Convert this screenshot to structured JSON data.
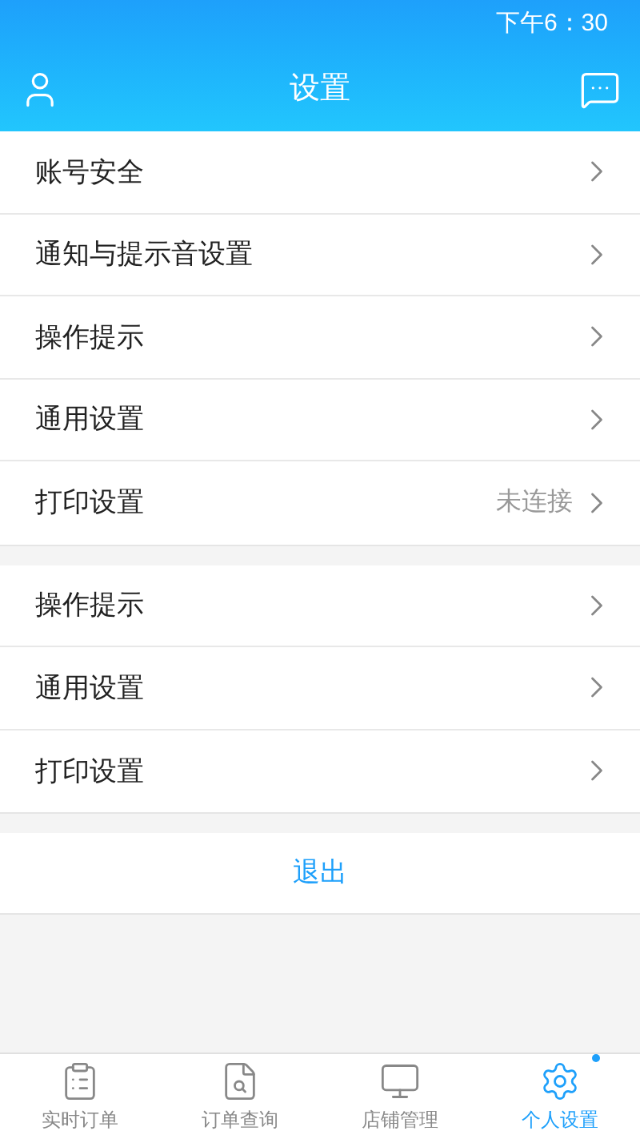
{
  "status_bar": {
    "time": "下午6：30"
  },
  "header": {
    "title": "设置"
  },
  "groups": [
    {
      "items": [
        {
          "label": "账号安全"
        },
        {
          "label": "通知与提示音设置"
        },
        {
          "label": "操作提示"
        },
        {
          "label": "通用设置"
        },
        {
          "label": "打印设置",
          "value": "未连接"
        }
      ]
    },
    {
      "items": [
        {
          "label": "操作提示"
        },
        {
          "label": "通用设置"
        },
        {
          "label": "打印设置"
        }
      ]
    }
  ],
  "logout": "退出",
  "bottom_nav": [
    {
      "label": "实时订单",
      "kind": "clipboard",
      "selected": false,
      "dot": false
    },
    {
      "label": "订单查询",
      "kind": "search-doc",
      "selected": false,
      "dot": false
    },
    {
      "label": "店铺管理",
      "kind": "monitor",
      "selected": false,
      "dot": false
    },
    {
      "label": "个人设置",
      "kind": "gear",
      "selected": true,
      "dot": true
    }
  ]
}
